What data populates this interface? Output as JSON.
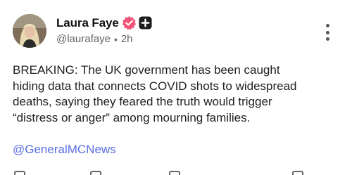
{
  "author": {
    "name": "Laura Faye",
    "handle": "@laurafaye",
    "separator": "•",
    "time": "2h",
    "verified_icon": "verified-badge-icon",
    "badge_icon": "plus-badge-icon"
  },
  "post": {
    "lines": [
      "BREAKING: The UK government has been caught",
      "hiding data that connects COVID shots to widespread",
      "deaths, saying they feared the truth would trigger",
      "“distress or anger” among mourning families."
    ],
    "mention": "@GeneralMCNews"
  },
  "colors": {
    "verified": "#f2557a",
    "badge": "#1c1c1c",
    "mention": "#5b6ee1",
    "text": "#1f1f1f",
    "meta": "#5f6368"
  },
  "actions": [
    "reply-icon",
    "repost-icon",
    "like-icon",
    "share-icon"
  ]
}
